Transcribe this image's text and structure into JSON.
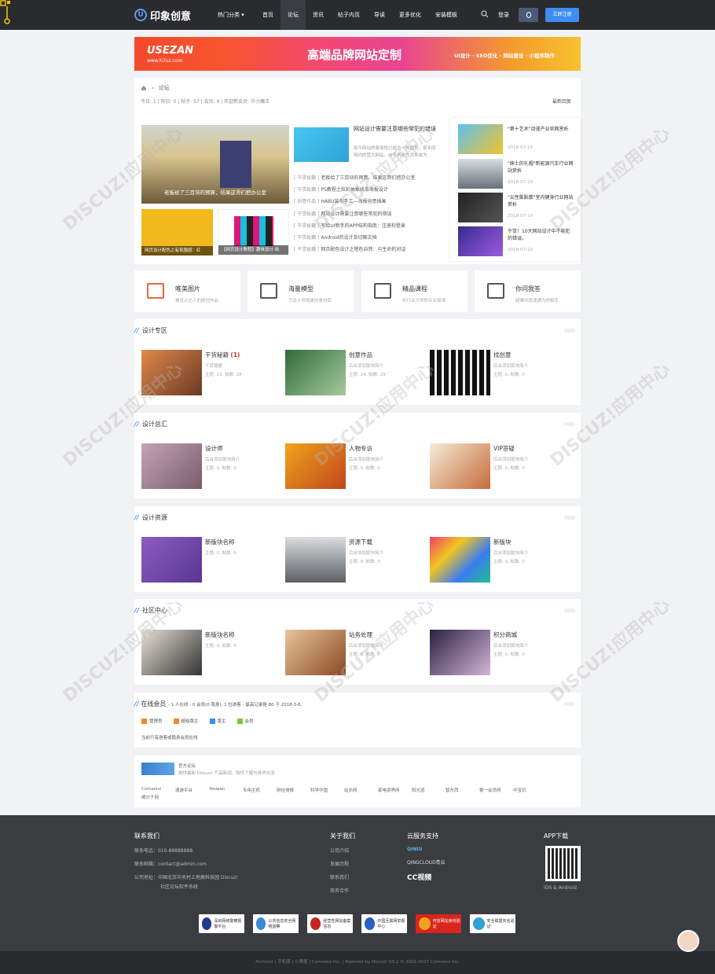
{
  "header": {
    "logo_text": "印象创意",
    "hot_label": "热门分类",
    "nav": [
      "首页",
      "论坛",
      "资讯",
      "帖子内页",
      "导读",
      "更多优化",
      "安装模板"
    ],
    "active_nav": "论坛",
    "login_label": "登录",
    "register_label": "立即注册"
  },
  "banner": {
    "brand": "USEZAN",
    "url": "www.h7uz.com",
    "headline": "高端品牌网站定制",
    "tags": "UI设计 · SEO优化 · 网站建设 · 小程序制作"
  },
  "breadcrumb": {
    "current": "论坛"
  },
  "stats": {
    "text": "今日: 1 | 昨日: 0 | 帖子: 57 | 会员: 9 | 欢迎新会员: 许小魔王",
    "latest": "最新回复"
  },
  "slider": {
    "caption": "老板给了三百块的预算，结果这哥们把办公室",
    "thumb1": "网页设计配色之有氛围感：红",
    "thumb2": "【网页设计教程】趣味设计·收"
  },
  "article": {
    "title": "网站设计需要注意哪些常犯的错误",
    "desc": "如今网站的渠用性已成为一种趋势，很多同网内的营大网站，似乎再用性并来成为"
  },
  "news": [
    {
      "cat": "[ 干货秘籍 ]",
      "title": "老板给了三百块的预算，结果这哥们把办公室"
    },
    {
      "cat": "[ 干货秘籍 ]",
      "title": "PS教程之炫彩抽象线条海报设计"
    },
    {
      "cat": "[ 创意作品 ]",
      "title": "HABU装布手工—海报创意插画"
    },
    {
      "cat": "[ 干货秘籍 ]",
      "title": "网站设计需要注意哪些常犯的错误"
    },
    {
      "cat": "[ 干货秘籍 ]",
      "title": "写给UI新手的APP结构指南：注册和登录"
    },
    {
      "cat": "[ 干货秘籍 ]",
      "title": "Android的设计及切图文档"
    },
    {
      "cat": "[ 干货秘籍 ]",
      "title": "网页配色设计之橙色自然：与生命的对话"
    }
  ],
  "right_list": [
    {
      "title": "\"第十艺术\"动漫产业官网赏析",
      "date": "2018-07-10"
    },
    {
      "title": "\"绅士的礼帽\"新能源汽车行业网站赏析",
      "date": "2018-07-10"
    },
    {
      "title": "\"尖性膨胀散\"室内健身行业网站赏析",
      "date": "2018-07-10"
    },
    {
      "title": "干货！10大网站设计中不能犯的错误。",
      "date": "2018-07-10"
    }
  ],
  "features": [
    {
      "title": "唯美图片",
      "desc": "看设计达人的原创作品"
    },
    {
      "title": "海量模型",
      "desc": "为设计师搭建的素材库"
    },
    {
      "title": "精品课程",
      "desc": "听行业大师的专业授课"
    },
    {
      "title": "你问我答",
      "desc": "疑难问题速通为你解答"
    }
  ],
  "sections": [
    {
      "title": "设计专区",
      "forums": [
        {
          "name": "干货秘籍",
          "count": "(1)",
          "l2": "干货秘籍",
          "l3": "主题: 23, 帖数: 28"
        },
        {
          "name": "创意作品",
          "count": "",
          "l2": "后台添加版块简介",
          "l3": "主题: 24, 帖数: 29"
        },
        {
          "name": "找创意",
          "count": "",
          "l2": "后台添加版块简介",
          "l3": "主题: 0, 帖数: 0"
        }
      ]
    },
    {
      "title": "设计总汇",
      "forums": [
        {
          "name": "设计师",
          "count": "",
          "l2": "后台添加版块简介",
          "l3": "主题: 0, 帖数: 0"
        },
        {
          "name": "人物专访",
          "count": "",
          "l2": "后台添加版块简介",
          "l3": "主题: 0, 帖数: 0"
        },
        {
          "name": "VIP答疑",
          "count": "",
          "l2": "后台添加版块简介",
          "l3": "主题: 0, 帖数: 0"
        }
      ]
    },
    {
      "title": "设计资源",
      "forums": [
        {
          "name": "新版块名称",
          "count": "",
          "l2": "主题: 0, 帖数: 0",
          "l3": ""
        },
        {
          "name": "资源下载",
          "count": "",
          "l2": "后台添加版块简介",
          "l3": "主题: 0, 帖数: 0"
        },
        {
          "name": "新版块",
          "count": "",
          "l2": "后台添加版块简介",
          "l3": "主题: 0, 帖数: 0"
        }
      ]
    },
    {
      "title": "社区中心",
      "forums": [
        {
          "name": "新版块名称",
          "count": "",
          "l2": "主题: 0, 帖数: 0",
          "l3": ""
        },
        {
          "name": "站务处理",
          "count": "",
          "l2": "后台添加版块简介",
          "l3": "主题: 0, 帖数: 0"
        },
        {
          "name": "积分商城",
          "count": "",
          "l2": "后台添加版块简介",
          "l3": "主题: 0, 帖数: 0"
        }
      ]
    }
  ],
  "online": {
    "title": "在线会员",
    "sub": "- 1 人在线 - 0 会员(0 隐身), 1 位游客 - 最高记录是 80 于 2018-3-6.",
    "legend": [
      "管理员",
      "超级版主",
      "版主",
      "会员"
    ],
    "legend_colors": [
      "#f08a24",
      "#f08a24",
      "#3d8df2",
      "#7cc63b"
    ],
    "note": "当前只有游客或隐身会员在线"
  },
  "links": {
    "title": "官方论坛",
    "desc": "提供最新 Discuz! 产品新闻、软件下载与技术交流",
    "items": [
      "Comsenz",
      "漫游平台",
      "Yeswan",
      "专用主机",
      "财经快报",
      "科学中国",
      "站长网",
      "家电资界网",
      "阳光道",
      "智东西",
      "第一会员网",
      "中宝讯",
      "威分子网"
    ]
  },
  "footer": {
    "contact_title": "联系我们",
    "phone": "联系电话：010-88888888",
    "email": "联系邮箱：contact@admin.com",
    "address1": "公司地址：中国北京中关村上地高科技园 Discuz!",
    "address2": "社区论坛软件系统",
    "about_title": "关于我们",
    "about": [
      "公司介绍",
      "发展历程",
      "联系我们",
      "商务合作"
    ],
    "cloud_title": "云服务支持",
    "cloud": [
      "QINIU",
      "QINGCLOUD青云",
      "CC视频"
    ],
    "app_title": "APP下载",
    "app_sub": "iOS & Android",
    "badges": [
      "深圳网络警察报警平台",
      "公共信息安全网络监察",
      "经营性网站备案信息",
      "中国互联网举报中心",
      "可信网站身份验证",
      "安全联盟实名验证"
    ],
    "copyright": "Archiver | 手机版 | 小黑屋 | Comsenz Inc. | Powered by Discuz! X3.2 © 2001-2017 Comsenz Inc."
  }
}
